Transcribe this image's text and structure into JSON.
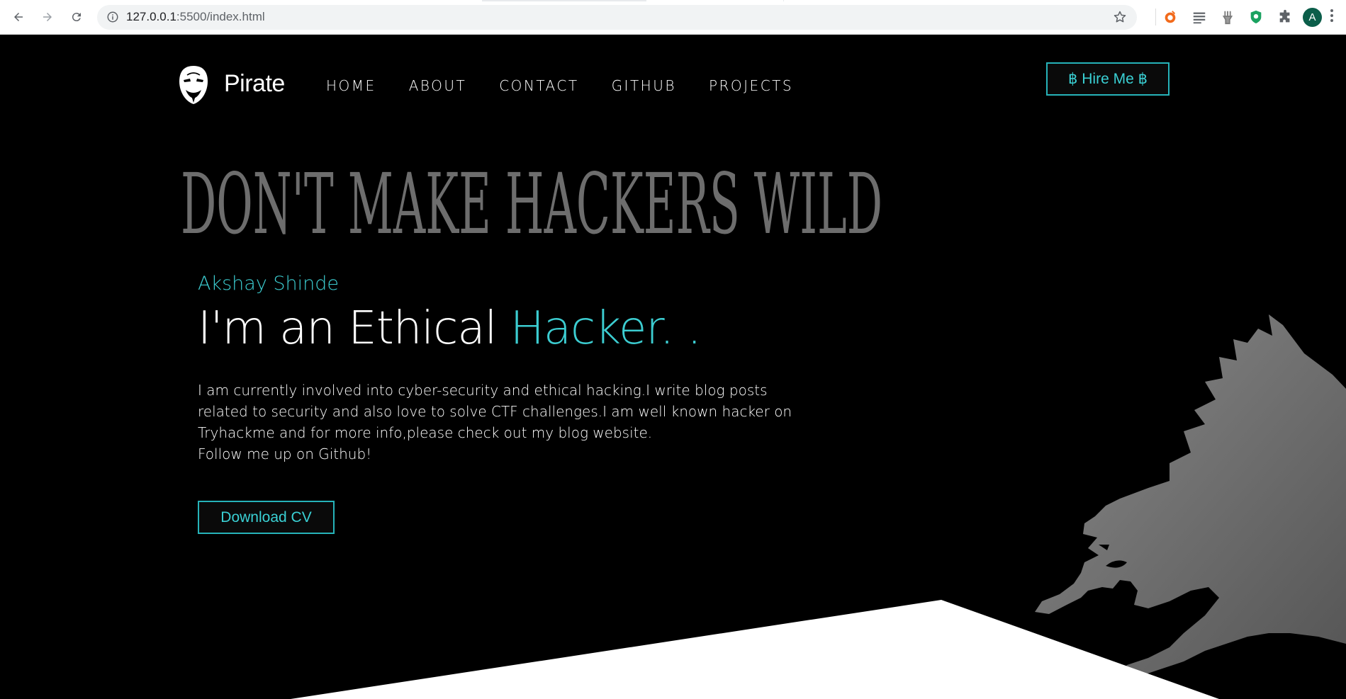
{
  "browser": {
    "url_host": "127.0.0.1",
    "url_rest": ":5500/index.html",
    "avatar_letter": "A",
    "icons": [
      "back-icon",
      "forward-icon",
      "reload-icon",
      "info-icon",
      "bookmark-star-icon",
      "extension-icon",
      "reader-icon",
      "antenna-extension-icon",
      "shield-extension-icon",
      "puzzle-icon",
      "profile-avatar",
      "menu-kebab-icon"
    ]
  },
  "nav": {
    "brand": "Pirate",
    "links": [
      "HOME",
      "ABOUT",
      "CONTACT",
      "GITHUB",
      "PROJECTS"
    ],
    "hire_label": "฿ Hire Me ฿"
  },
  "hero": {
    "banner": "DON'T MAKE HACKERS WILD",
    "name": "Akshay Shinde",
    "headline_prefix": "I'm an Ethical ",
    "headline_accent": "Hacker. .",
    "bio_lines": [
      "I am currently involved into cyber-security and ethical hacking.I write blog posts",
      "related to security and also love to solve CTF challenges.I am well known hacker on",
      "Tryhackme and for more info,please check out my blog website.",
      "Follow me up on Github!"
    ],
    "cv_label": "Download CV"
  },
  "colors": {
    "accent": "#3ccdd1",
    "background": "#000000",
    "banner": "#6d6d6d",
    "beast": "#7a7a7a"
  }
}
